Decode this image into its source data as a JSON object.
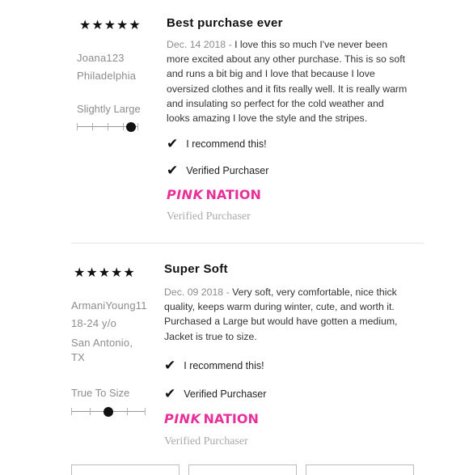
{
  "reviews": [
    {
      "stars": "★★★★★",
      "username": "Joana123",
      "location_line1": "Philadelphia",
      "location_line2": "",
      "age": "",
      "fit_label": "Slightly Large",
      "fit_level": 0.875,
      "title": "Best purchase ever",
      "date": "Dec. 14 2018",
      "separator": " - ",
      "text": "I love this so much I've never been more excited about any other purchase. This is so soft and runs a bit big and I love that because I love oversized clothes and it fits really well. It is really warm and insulating so perfect for the cold weather and looks amazing I love the style and the stripes.",
      "recommend": "I recommend this!",
      "verified": "Verified Purchaser",
      "logo_part1": "PINK",
      "logo_part2": "NATION",
      "verified_badge": "Verified Purchaser"
    },
    {
      "stars": "★★★★★",
      "username": "ArmaniYoung11",
      "age": "18-24 y/o",
      "location_line1": "San Antonio,",
      "location_line2": "TX",
      "fit_label": "True To Size",
      "fit_level": 0.5,
      "title": "Super Soft",
      "date": "Dec. 09 2018",
      "separator": " - ",
      "text": "Very soft, very comfortable, nice thick quality, keeps warm during winter, cute, and worth it. Purchased a Large but would have gotten a medium, Jacket is true to size.",
      "recommend": "I recommend this!",
      "verified": "Verified Purchaser",
      "logo_part1": "PINK",
      "logo_part2": "NATION",
      "verified_badge": "Verified Purchaser"
    }
  ],
  "icons": {
    "check": "check-icon",
    "star": "star-icon"
  }
}
